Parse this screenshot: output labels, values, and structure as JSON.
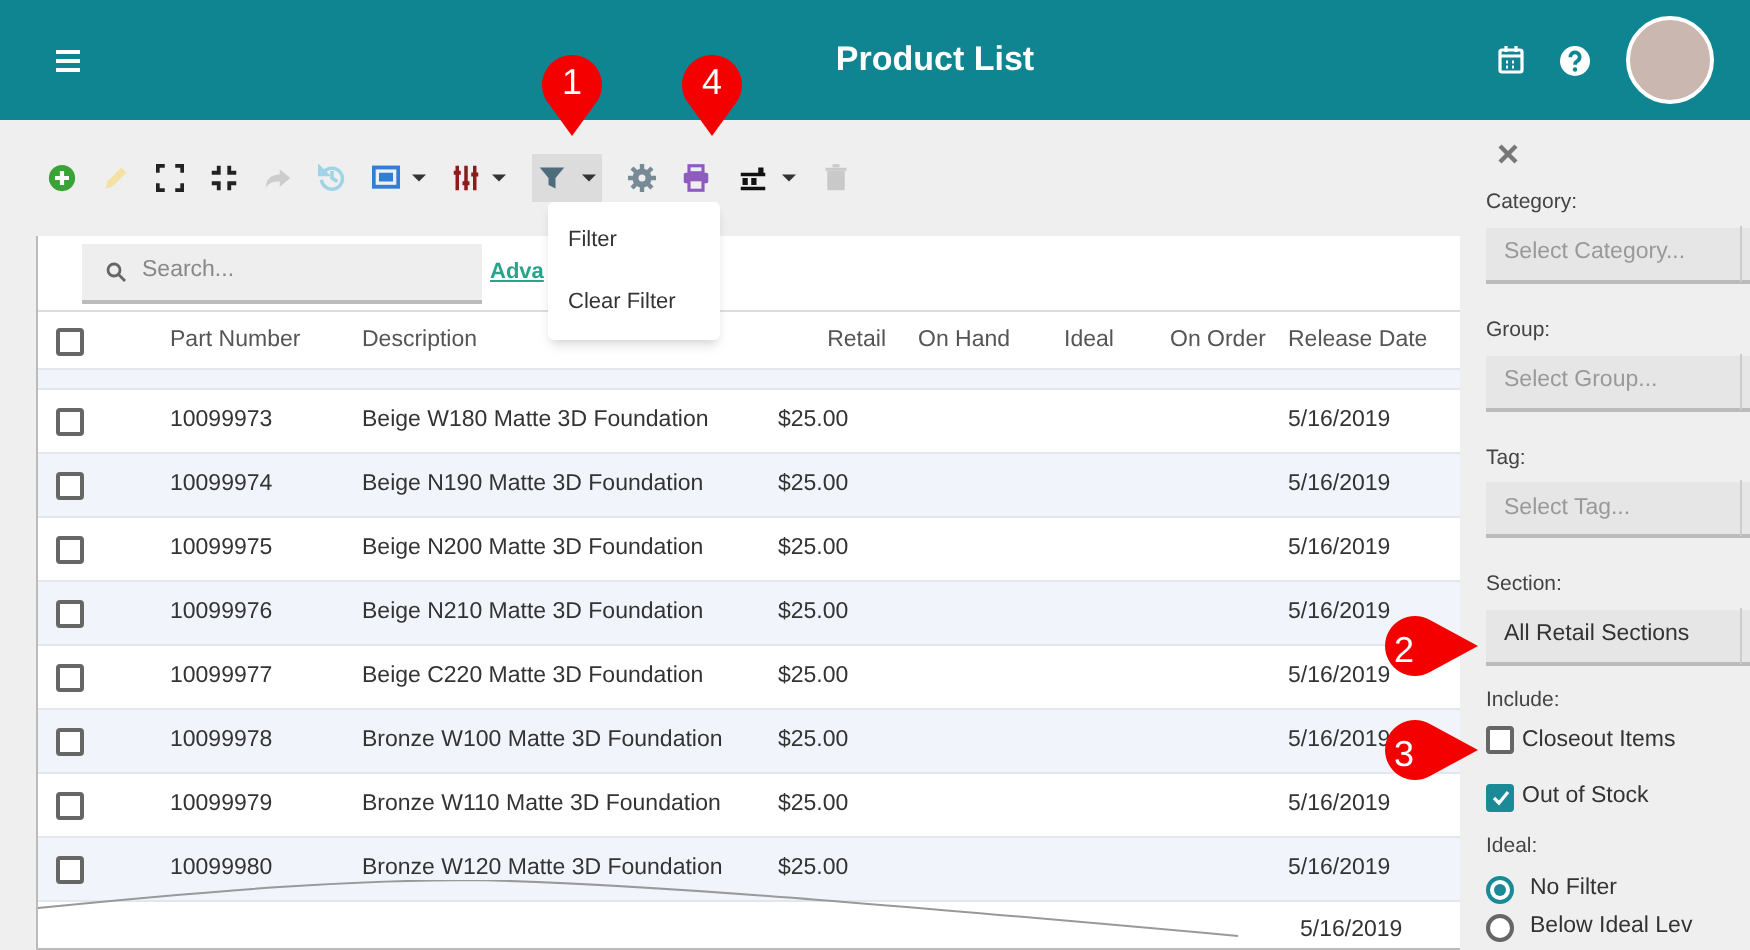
{
  "header": {
    "title": "Product List"
  },
  "filter_menu": {
    "items": [
      "Filter",
      "Clear Filter"
    ]
  },
  "search": {
    "placeholder": "Search...",
    "advanced_link": "Adva"
  },
  "table": {
    "select_all_checked": false,
    "columns": [
      "Part Number",
      "Description",
      "Retail",
      "On Hand",
      "Ideal",
      "On Order",
      "Release Date"
    ],
    "rows": [
      {
        "checked": false,
        "cells": [
          "10099973",
          "Beige W180 Matte 3D Foundation",
          "$25.00",
          "",
          "",
          "",
          "5/16/2019"
        ]
      },
      {
        "checked": false,
        "cells": [
          "10099974",
          "Beige N190 Matte 3D Foundation",
          "$25.00",
          "",
          "",
          "",
          "5/16/2019"
        ]
      },
      {
        "checked": false,
        "cells": [
          "10099975",
          "Beige N200 Matte 3D Foundation",
          "$25.00",
          "",
          "",
          "",
          "5/16/2019"
        ]
      },
      {
        "checked": false,
        "cells": [
          "10099976",
          "Beige N210 Matte 3D Foundation",
          "$25.00",
          "",
          "",
          "",
          "5/16/2019"
        ]
      },
      {
        "checked": false,
        "cells": [
          "10099977",
          "Beige C220 Matte 3D Foundation",
          "$25.00",
          "",
          "",
          "",
          "5/16/2019"
        ]
      },
      {
        "checked": false,
        "cells": [
          "10099978",
          "Bronze W100 Matte 3D Foundation",
          "$25.00",
          "",
          "",
          "",
          "5/16/2019"
        ]
      },
      {
        "checked": false,
        "cells": [
          "10099979",
          "Bronze W110 Matte 3D Foundation",
          "$25.00",
          "",
          "",
          "",
          "5/16/2019"
        ]
      },
      {
        "checked": false,
        "cells": [
          "10099980",
          "Bronze W120 Matte 3D Foundation",
          "$25.00",
          "",
          "",
          "",
          "5/16/2019"
        ]
      }
    ],
    "partial_row": {
      "release_date": "5/16/2019"
    }
  },
  "side_panel": {
    "selects": [
      {
        "label": "Category:",
        "placeholder": "Select Category..."
      },
      {
        "label": "Group:",
        "placeholder": "Select Group..."
      },
      {
        "label": "Tag:",
        "placeholder": "Select Tag..."
      },
      {
        "label": "Section:",
        "value": "All Retail Sections"
      }
    ],
    "include_label": "Include:",
    "include": [
      {
        "label": "Closeout Items",
        "checked": false
      },
      {
        "label": "Out of Stock",
        "checked": true
      }
    ],
    "ideal_label": "Ideal:",
    "ideal": [
      {
        "label": "No Filter",
        "selected": true
      },
      {
        "label": "Below Ideal Lev",
        "selected": false
      }
    ]
  },
  "callouts": [
    "1",
    "4",
    "2",
    "3"
  ]
}
